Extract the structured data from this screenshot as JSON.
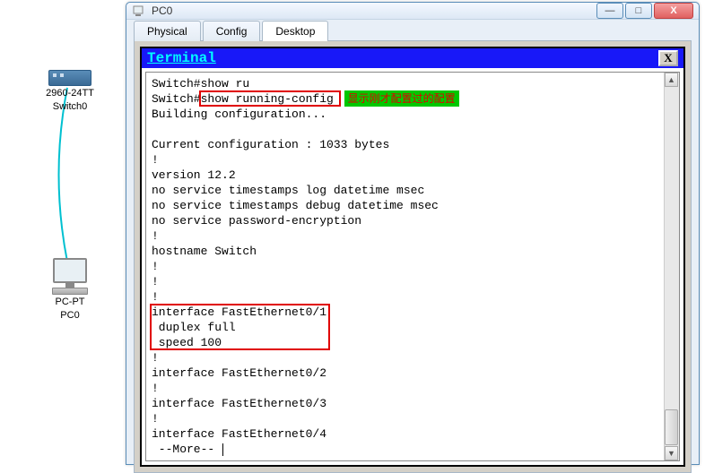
{
  "topology": {
    "switch_line1": "2960-24TT",
    "switch_line2": "Switch0",
    "pc_line1": "PC-PT",
    "pc_line2": "PC0"
  },
  "window": {
    "title": "PC0",
    "minimize": "—",
    "maximize": "□",
    "close": "X"
  },
  "tabs": {
    "physical": "Physical",
    "config": "Config",
    "desktop": "Desktop"
  },
  "terminal": {
    "title": "Terminal",
    "close": "X",
    "annotation": "显示刚才配置过的配置",
    "lines": [
      "Switch#show ru",
      "Switch#show running-config ",
      "Building configuration...",
      "",
      "Current configuration : 1033 bytes",
      "!",
      "version 12.2",
      "no service timestamps log datetime msec",
      "no service timestamps debug datetime msec",
      "no service password-encryption",
      "!",
      "hostname Switch",
      "!",
      "!",
      "!",
      "interface FastEthernet0/1",
      " duplex full",
      " speed 100",
      "!",
      "interface FastEthernet0/2",
      "!",
      "interface FastEthernet0/3",
      "!",
      "interface FastEthernet0/4",
      " --More-- "
    ]
  }
}
